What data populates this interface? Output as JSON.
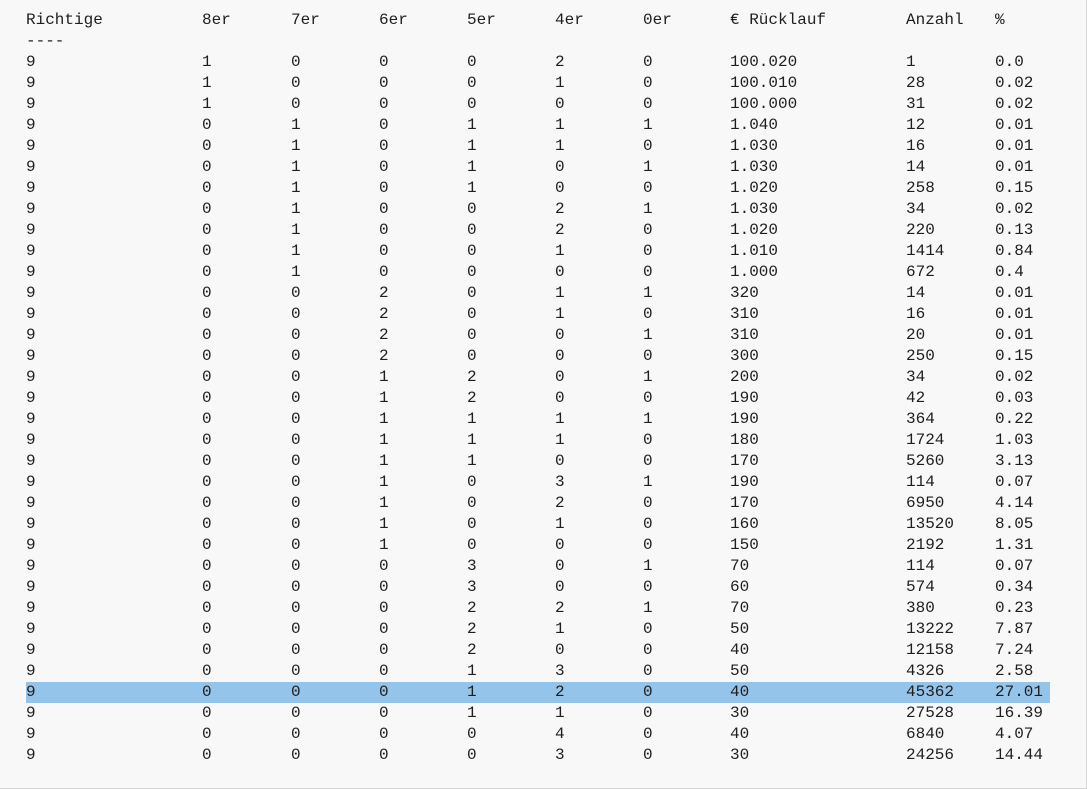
{
  "headers": [
    "Richtige",
    "8er",
    "7er",
    "6er",
    "5er",
    "4er",
    "0er",
    "€ Rücklauf",
    "Anzahl",
    "%"
  ],
  "separator": "----",
  "highlight_row": 30,
  "highlight_color": "#94c4ea",
  "rows": [
    [
      "9",
      "1",
      "0",
      "0",
      "0",
      "2",
      "0",
      "100.020",
      "1",
      "0.0"
    ],
    [
      "9",
      "1",
      "0",
      "0",
      "0",
      "1",
      "0",
      "100.010",
      "28",
      "0.02"
    ],
    [
      "9",
      "1",
      "0",
      "0",
      "0",
      "0",
      "0",
      "100.000",
      "31",
      "0.02"
    ],
    [
      "9",
      "0",
      "1",
      "0",
      "1",
      "1",
      "1",
      "1.040",
      "12",
      "0.01"
    ],
    [
      "9",
      "0",
      "1",
      "0",
      "1",
      "1",
      "0",
      "1.030",
      "16",
      "0.01"
    ],
    [
      "9",
      "0",
      "1",
      "0",
      "1",
      "0",
      "1",
      "1.030",
      "14",
      "0.01"
    ],
    [
      "9",
      "0",
      "1",
      "0",
      "1",
      "0",
      "0",
      "1.020",
      "258",
      "0.15"
    ],
    [
      "9",
      "0",
      "1",
      "0",
      "0",
      "2",
      "1",
      "1.030",
      "34",
      "0.02"
    ],
    [
      "9",
      "0",
      "1",
      "0",
      "0",
      "2",
      "0",
      "1.020",
      "220",
      "0.13"
    ],
    [
      "9",
      "0",
      "1",
      "0",
      "0",
      "1",
      "0",
      "1.010",
      "1414",
      "0.84"
    ],
    [
      "9",
      "0",
      "1",
      "0",
      "0",
      "0",
      "0",
      "1.000",
      "672",
      "0.4"
    ],
    [
      "9",
      "0",
      "0",
      "2",
      "0",
      "1",
      "1",
      "320",
      "14",
      "0.01"
    ],
    [
      "9",
      "0",
      "0",
      "2",
      "0",
      "1",
      "0",
      "310",
      "16",
      "0.01"
    ],
    [
      "9",
      "0",
      "0",
      "2",
      "0",
      "0",
      "1",
      "310",
      "20",
      "0.01"
    ],
    [
      "9",
      "0",
      "0",
      "2",
      "0",
      "0",
      "0",
      "300",
      "250",
      "0.15"
    ],
    [
      "9",
      "0",
      "0",
      "1",
      "2",
      "0",
      "1",
      "200",
      "34",
      "0.02"
    ],
    [
      "9",
      "0",
      "0",
      "1",
      "2",
      "0",
      "0",
      "190",
      "42",
      "0.03"
    ],
    [
      "9",
      "0",
      "0",
      "1",
      "1",
      "1",
      "1",
      "190",
      "364",
      "0.22"
    ],
    [
      "9",
      "0",
      "0",
      "1",
      "1",
      "1",
      "0",
      "180",
      "1724",
      "1.03"
    ],
    [
      "9",
      "0",
      "0",
      "1",
      "1",
      "0",
      "0",
      "170",
      "5260",
      "3.13"
    ],
    [
      "9",
      "0",
      "0",
      "1",
      "0",
      "3",
      "1",
      "190",
      "114",
      "0.07"
    ],
    [
      "9",
      "0",
      "0",
      "1",
      "0",
      "2",
      "0",
      "170",
      "6950",
      "4.14"
    ],
    [
      "9",
      "0",
      "0",
      "1",
      "0",
      "1",
      "0",
      "160",
      "13520",
      "8.05"
    ],
    [
      "9",
      "0",
      "0",
      "1",
      "0",
      "0",
      "0",
      "150",
      "2192",
      "1.31"
    ],
    [
      "9",
      "0",
      "0",
      "0",
      "3",
      "0",
      "1",
      "70",
      "114",
      "0.07"
    ],
    [
      "9",
      "0",
      "0",
      "0",
      "3",
      "0",
      "0",
      "60",
      "574",
      "0.34"
    ],
    [
      "9",
      "0",
      "0",
      "0",
      "2",
      "2",
      "1",
      "70",
      "380",
      "0.23"
    ],
    [
      "9",
      "0",
      "0",
      "0",
      "2",
      "1",
      "0",
      "50",
      "13222",
      "7.87"
    ],
    [
      "9",
      "0",
      "0",
      "0",
      "2",
      "0",
      "0",
      "40",
      "12158",
      "7.24"
    ],
    [
      "9",
      "0",
      "0",
      "0",
      "1",
      "3",
      "0",
      "50",
      "4326",
      "2.58"
    ],
    [
      "9",
      "0",
      "0",
      "0",
      "1",
      "2",
      "0",
      "40",
      "45362",
      "27.01"
    ],
    [
      "9",
      "0",
      "0",
      "0",
      "1",
      "1",
      "0",
      "30",
      "27528",
      "16.39"
    ],
    [
      "9",
      "0",
      "0",
      "0",
      "0",
      "4",
      "0",
      "40",
      "6840",
      "4.07"
    ],
    [
      "9",
      "0",
      "0",
      "0",
      "0",
      "3",
      "0",
      "30",
      "24256",
      "14.44"
    ]
  ]
}
